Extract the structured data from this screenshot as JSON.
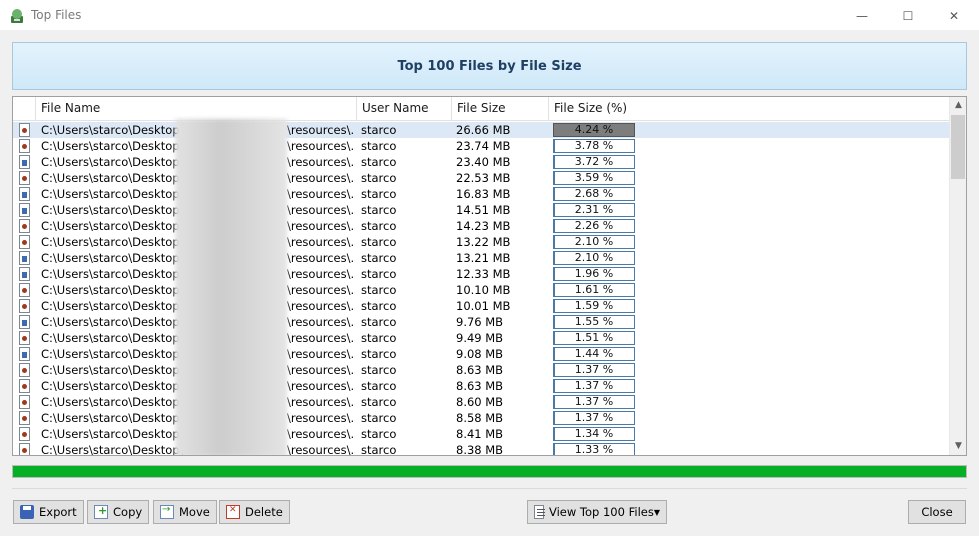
{
  "window": {
    "title": "Top Files",
    "controls": {
      "minimize": "—",
      "maximize": "☐",
      "close": "✕"
    }
  },
  "banner": {
    "title": "Top 100 Files by File Size"
  },
  "grid": {
    "columns": [
      "File Name",
      "User Name",
      "File Size",
      "File Size (%)"
    ],
    "rows": [
      {
        "icon": "media-file-icon",
        "path_start": "C:\\Users\\starco\\Desktop\\",
        "path_end": "\\resources\\...",
        "user": "starco",
        "size": "26.66 MB",
        "percent_label": "4.24 %",
        "percent": 4.24,
        "selected": true
      },
      {
        "icon": "media-file-icon",
        "path_start": "C:\\Users\\starco\\Desktop\\",
        "path_end": "\\resources\\...",
        "user": "starco",
        "size": "23.74 MB",
        "percent_label": "3.78 %",
        "percent": 3.78
      },
      {
        "icon": "document-file-icon",
        "path_start": "C:\\Users\\starco\\Desktop\\",
        "path_end": "\\resources\\...",
        "user": "starco",
        "size": "23.40 MB",
        "percent_label": "3.72 %",
        "percent": 3.72
      },
      {
        "icon": "media-file-icon",
        "path_start": "C:\\Users\\starco\\Desktop\\",
        "path_end": "\\resources\\...",
        "user": "starco",
        "size": "22.53 MB",
        "percent_label": "3.59 %",
        "percent": 3.59
      },
      {
        "icon": "document-file-icon",
        "path_start": "C:\\Users\\starco\\Desktop\\",
        "path_end": "\\resources\\...",
        "user": "starco",
        "size": "16.83 MB",
        "percent_label": "2.68 %",
        "percent": 2.68
      },
      {
        "icon": "document-file-icon",
        "path_start": "C:\\Users\\starco\\Desktop\\",
        "path_end": "\\resources\\...",
        "user": "starco",
        "size": "14.51 MB",
        "percent_label": "2.31 %",
        "percent": 2.31
      },
      {
        "icon": "media-file-icon",
        "path_start": "C:\\Users\\starco\\Desktop\\",
        "path_end": "\\resources\\...",
        "user": "starco",
        "size": "14.23 MB",
        "percent_label": "2.26 %",
        "percent": 2.26
      },
      {
        "icon": "media-file-icon",
        "path_start": "C:\\Users\\starco\\Desktop\\",
        "path_end": "\\resources\\...",
        "user": "starco",
        "size": "13.22 MB",
        "percent_label": "2.10 %",
        "percent": 2.1
      },
      {
        "icon": "document-file-icon",
        "path_start": "C:\\Users\\starco\\Desktop\\",
        "path_end": "\\resources\\...",
        "user": "starco",
        "size": "13.21 MB",
        "percent_label": "2.10 %",
        "percent": 2.1
      },
      {
        "icon": "document-file-icon",
        "path_start": "C:\\Users\\starco\\Desktop\\",
        "path_end": "\\resources\\...",
        "user": "starco",
        "size": "12.33 MB",
        "percent_label": "1.96 %",
        "percent": 1.96
      },
      {
        "icon": "media-file-icon",
        "path_start": "C:\\Users\\starco\\Desktop\\",
        "path_end": "\\resources\\...",
        "user": "starco",
        "size": "10.10 MB",
        "percent_label": "1.61 %",
        "percent": 1.61
      },
      {
        "icon": "media-file-icon",
        "path_start": "C:\\Users\\starco\\Desktop\\",
        "path_end": "\\resources\\...",
        "user": "starco",
        "size": "10.01 MB",
        "percent_label": "1.59 %",
        "percent": 1.59
      },
      {
        "icon": "document-file-icon",
        "path_start": "C:\\Users\\starco\\Desktop\\",
        "path_end": "\\resources\\...",
        "user": "starco",
        "size": "9.76 MB",
        "percent_label": "1.55 %",
        "percent": 1.55
      },
      {
        "icon": "media-file-icon",
        "path_start": "C:\\Users\\starco\\Desktop\\",
        "path_end": "\\resources\\...",
        "user": "starco",
        "size": "9.49 MB",
        "percent_label": "1.51 %",
        "percent": 1.51
      },
      {
        "icon": "document-file-icon",
        "path_start": "C:\\Users\\starco\\Desktop\\",
        "path_end": "\\resources\\...",
        "user": "starco",
        "size": "9.08 MB",
        "percent_label": "1.44 %",
        "percent": 1.44
      },
      {
        "icon": "media-file-icon",
        "path_start": "C:\\Users\\starco\\Desktop\\",
        "path_end": "\\resources\\...",
        "user": "starco",
        "size": "8.63 MB",
        "percent_label": "1.37 %",
        "percent": 1.37
      },
      {
        "icon": "media-file-icon",
        "path_start": "C:\\Users\\starco\\Desktop\\",
        "path_end": "\\resources\\...",
        "user": "starco",
        "size": "8.63 MB",
        "percent_label": "1.37 %",
        "percent": 1.37
      },
      {
        "icon": "media-file-icon",
        "path_start": "C:\\Users\\starco\\Desktop\\",
        "path_end": "\\resources\\...",
        "user": "starco",
        "size": "8.60 MB",
        "percent_label": "1.37 %",
        "percent": 1.37
      },
      {
        "icon": "media-file-icon",
        "path_start": "C:\\Users\\starco\\Desktop\\",
        "path_end": "\\resources\\...",
        "user": "starco",
        "size": "8.58 MB",
        "percent_label": "1.37 %",
        "percent": 1.37
      },
      {
        "icon": "media-file-icon",
        "path_start": "C:\\Users\\starco\\Desktop\\",
        "path_end": "\\resources\\...",
        "user": "starco",
        "size": "8.41 MB",
        "percent_label": "1.34 %",
        "percent": 1.34
      },
      {
        "icon": "media-file-icon",
        "path_start": "C:\\Users\\starco\\Desktop\\",
        "path_end": "\\resources\\...",
        "user": "starco",
        "size": "8.38 MB",
        "percent_label": "1.33 %",
        "percent": 1.33
      }
    ],
    "percent_bar_max": 5
  },
  "scan_progress": {
    "fraction": 1.0,
    "color": "#06b025"
  },
  "buttons": {
    "export": "Export",
    "copy": "Copy",
    "move": "Move",
    "delete": "Delete",
    "view": "View Top 100 Files",
    "close": "Close"
  },
  "colors": {
    "banner_text": "#1f3f63",
    "selected_row": "#dde8f6",
    "percent_bar": "#4a7aa8"
  }
}
